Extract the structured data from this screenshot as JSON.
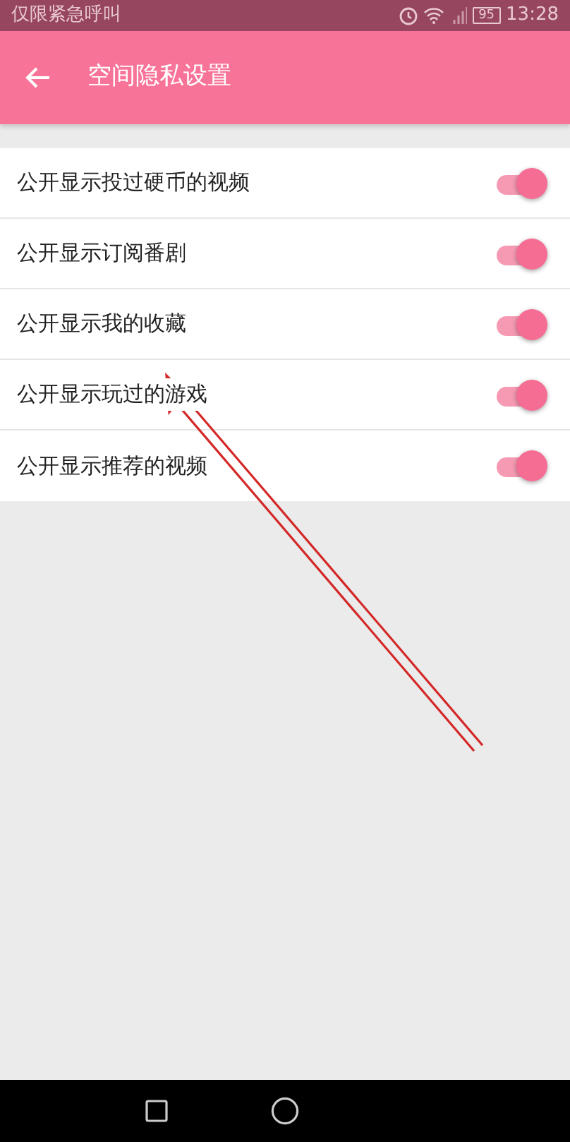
{
  "status_bar": {
    "notice": "仅限紧急呼叫",
    "battery": "95",
    "time": "13:28"
  },
  "header": {
    "title": "空间隐私设置"
  },
  "settings": [
    {
      "label": "公开显示投过硬币的视频",
      "on": true
    },
    {
      "label": "公开显示订阅番剧",
      "on": true
    },
    {
      "label": "公开显示我的收藏",
      "on": true
    },
    {
      "label": "公开显示玩过的游戏",
      "on": true
    },
    {
      "label": "公开显示推荐的视频",
      "on": true
    }
  ]
}
